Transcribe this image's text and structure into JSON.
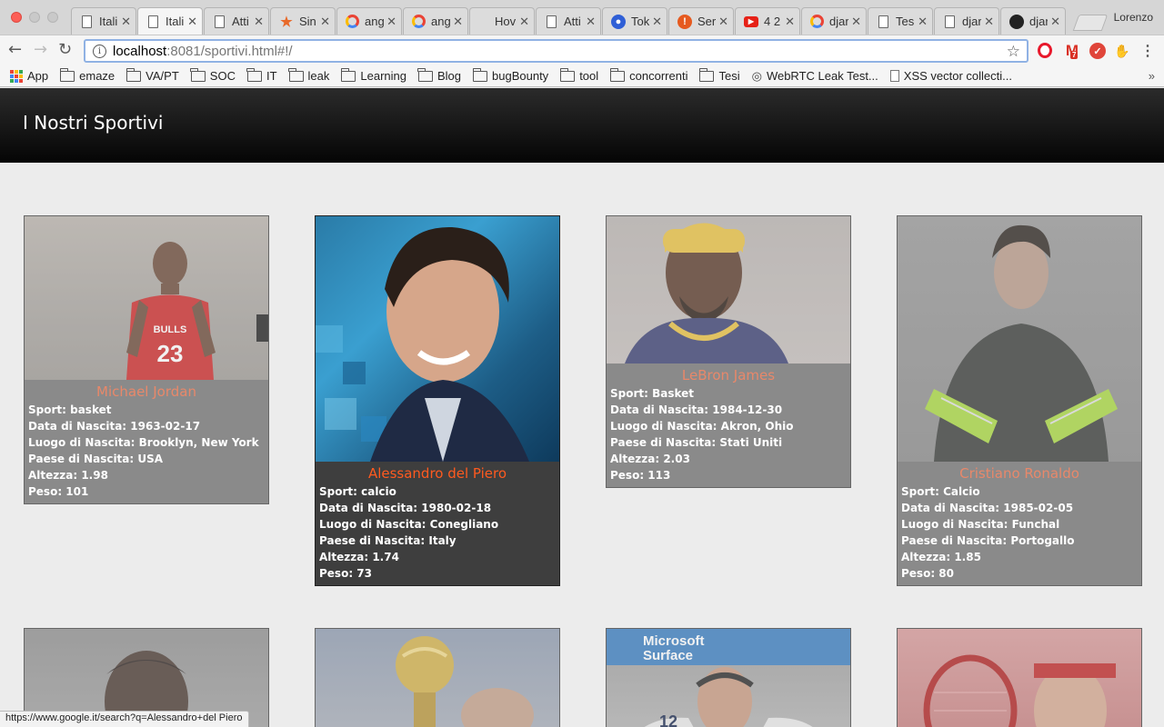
{
  "browser": {
    "profile_name": "Lorenzo",
    "tabs": [
      {
        "title": "Itali",
        "icon": "doc-icon",
        "active": false
      },
      {
        "title": "Itali",
        "icon": "doc-icon",
        "active": true
      },
      {
        "title": "Atti",
        "icon": "doc-icon",
        "active": false
      },
      {
        "title": "Sin",
        "icon": "star-icon",
        "active": false
      },
      {
        "title": "ang",
        "icon": "google-icon",
        "active": false
      },
      {
        "title": "ang",
        "icon": "google-icon",
        "active": false
      },
      {
        "title": "Hov",
        "icon": "none",
        "active": false
      },
      {
        "title": "Atti",
        "icon": "doc-icon",
        "active": false
      },
      {
        "title": "Tok",
        "icon": "circle-blue-icon",
        "active": false
      },
      {
        "title": "Ser",
        "icon": "circle-orange-icon",
        "active": false
      },
      {
        "title": "4 2",
        "icon": "youtube-icon",
        "active": false
      },
      {
        "title": "djar",
        "icon": "google-icon",
        "active": false
      },
      {
        "title": "Tes",
        "icon": "doc-icon",
        "active": false
      },
      {
        "title": "djar",
        "icon": "doc-icon",
        "active": false
      },
      {
        "title": "djar",
        "icon": "github-icon",
        "active": false
      }
    ],
    "address": {
      "host": "localhost",
      "rest": ":8081/sportivi.html#!/"
    },
    "gmail_badge": "7",
    "bookmarks": [
      {
        "label": "App",
        "icon": "apps-icon"
      },
      {
        "label": "emaze",
        "icon": "folder-icon"
      },
      {
        "label": "VA/PT",
        "icon": "folder-icon"
      },
      {
        "label": "SOC",
        "icon": "folder-icon"
      },
      {
        "label": "IT",
        "icon": "folder-icon"
      },
      {
        "label": "leak",
        "icon": "folder-icon"
      },
      {
        "label": "Learning",
        "icon": "folder-icon"
      },
      {
        "label": "Blog",
        "icon": "folder-icon"
      },
      {
        "label": "bugBounty",
        "icon": "folder-icon"
      },
      {
        "label": "tool",
        "icon": "folder-icon"
      },
      {
        "label": "concorrenti",
        "icon": "folder-icon"
      },
      {
        "label": "Tesi",
        "icon": "folder-icon"
      },
      {
        "label": "WebRTC Leak Test...",
        "icon": "fingerprint-icon"
      },
      {
        "label": "XSS vector collecti...",
        "icon": "page-icon"
      }
    ],
    "bookmarks_more": "»",
    "status_url": "https://www.google.it/search?q=Alessandro+del Piero"
  },
  "page": {
    "title": "I Nostri Sportivi"
  },
  "athletes": [
    {
      "name": "Michael Jordan",
      "sport": "basket",
      "birth_date": "1963-02-17",
      "birth_place": "Brooklyn, New York",
      "birth_country": "USA",
      "height": "1.98",
      "weight": "101"
    },
    {
      "name": "Alessandro del Piero",
      "sport": "calcio",
      "birth_date": "1980-02-18",
      "birth_place": "Conegliano",
      "birth_country": "Italy",
      "height": "1.74",
      "weight": "73"
    },
    {
      "name": "LeBron James",
      "sport": "Basket",
      "birth_date": "1984-12-30",
      "birth_place": "Akron, Ohio",
      "birth_country": "Stati Uniti",
      "height": "2.03",
      "weight": "113"
    },
    {
      "name": "Cristiano Ronaldo",
      "sport": "Calcio",
      "birth_date": "1985-02-05",
      "birth_place": "Funchal",
      "birth_country": "Portogallo",
      "height": "1.85",
      "weight": "80"
    }
  ],
  "labels": {
    "sport": "Sport: ",
    "birth_date": "Data di Nascita: ",
    "birth_place": "Luogo di Nascita: ",
    "birth_country": "Paese di Nascita: ",
    "height": "Altezza: ",
    "weight": "Peso: "
  },
  "photo_texts": {
    "jersey_team": "BULLS",
    "jersey_number": "23",
    "brand_line1": "Microsoft",
    "brand_line2": "Surface",
    "jersey_number_2": "12"
  }
}
